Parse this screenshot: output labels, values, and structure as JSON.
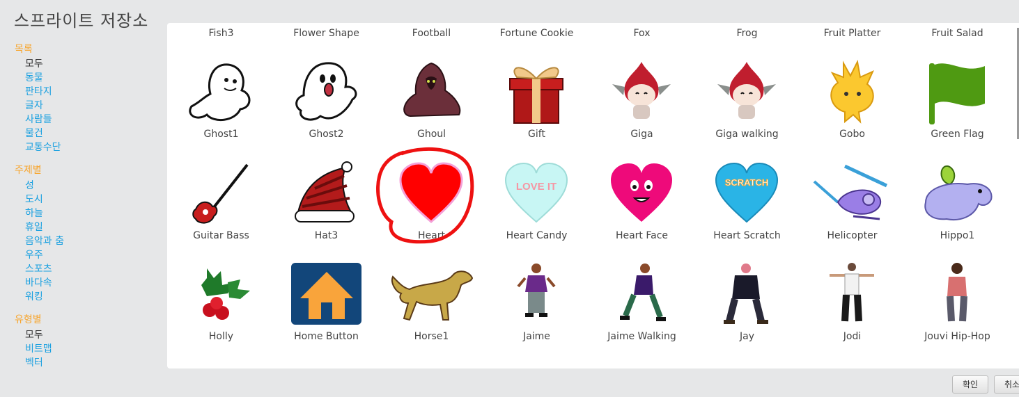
{
  "title": "스프라이트 저장소",
  "sidebar": {
    "groups": [
      {
        "heading": "목록",
        "items": [
          "모두",
          "동물",
          "판타지",
          "글자",
          "사람들",
          "물건",
          "교통수단"
        ]
      },
      {
        "heading": "주제별",
        "items": [
          "성",
          "도시",
          "하늘",
          "휴일",
          "음악과 춤",
          "우주",
          "스포츠",
          "바다속",
          "워킹"
        ]
      },
      {
        "heading": "유형별",
        "items": [
          "모두",
          "비트맵",
          "벡터"
        ]
      }
    ]
  },
  "library": {
    "top_row_labels": [
      "Fish3",
      "Flower Shape",
      "Football",
      "Fortune Cookie",
      "Fox",
      "Frog",
      "Fruit Platter",
      "Fruit Salad"
    ],
    "row1": [
      {
        "label": "Ghost1",
        "icon": "ghost1-icon"
      },
      {
        "label": "Ghost2",
        "icon": "ghost2-icon"
      },
      {
        "label": "Ghoul",
        "icon": "ghoul-icon"
      },
      {
        "label": "Gift",
        "icon": "gift-icon"
      },
      {
        "label": "Giga",
        "icon": "giga-icon"
      },
      {
        "label": "Giga walking",
        "icon": "giga-walking-icon"
      },
      {
        "label": "Gobo",
        "icon": "gobo-icon"
      },
      {
        "label": "Green Flag",
        "icon": "green-flag-icon"
      }
    ],
    "row2": [
      {
        "label": "Guitar Bass",
        "icon": "guitar-bass-icon"
      },
      {
        "label": "Hat3",
        "icon": "hat3-icon"
      },
      {
        "label": "Heart",
        "icon": "heart-icon"
      },
      {
        "label": "Heart Candy",
        "icon": "heart-candy-icon",
        "text": "LOVE IT"
      },
      {
        "label": "Heart Face",
        "icon": "heart-face-icon"
      },
      {
        "label": "Heart Scratch",
        "icon": "heart-scratch-icon",
        "text": "SCRATCH"
      },
      {
        "label": "Helicopter",
        "icon": "helicopter-icon"
      },
      {
        "label": "Hippo1",
        "icon": "hippo1-icon"
      }
    ],
    "row3": [
      {
        "label": "Holly",
        "icon": "holly-icon"
      },
      {
        "label": "Home Button",
        "icon": "home-button-icon"
      },
      {
        "label": "Horse1",
        "icon": "horse1-icon"
      },
      {
        "label": "Jaime",
        "icon": "jaime-icon"
      },
      {
        "label": "Jaime Walking",
        "icon": "jaime-walking-icon"
      },
      {
        "label": "Jay",
        "icon": "jay-icon"
      },
      {
        "label": "Jodi",
        "icon": "jodi-icon"
      },
      {
        "label": "Jouvi Hip-Hop",
        "icon": "jouvi-hip-hop-icon"
      }
    ]
  },
  "buttons": {
    "ok": "확인",
    "cancel": "취소"
  },
  "colors": {
    "accent_orange": "#f7a52d",
    "link_blue": "#1aa0e0",
    "highlight_red": "#ee1111"
  }
}
